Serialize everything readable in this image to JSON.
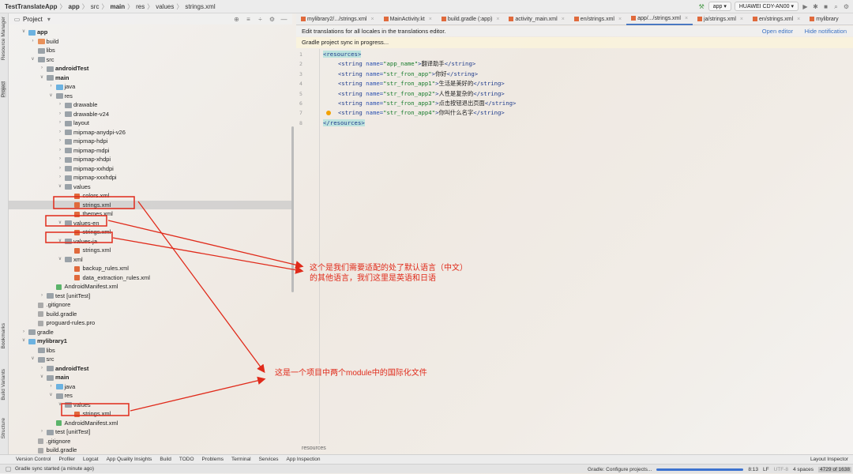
{
  "breadcrumb": [
    "TestTranslateApp",
    "app",
    "src",
    "main",
    "res",
    "values",
    "strings.xml"
  ],
  "run": {
    "config": "app",
    "device": "HUAWEI CDY-AN00"
  },
  "project_panel": {
    "title": "Project"
  },
  "side_tools": [
    "Resource Manager",
    "Project",
    "Bookmarks",
    "Build Variants",
    "Structure"
  ],
  "tree": [
    {
      "label": "app",
      "level": 0,
      "icon": "module",
      "open": true,
      "bold": true
    },
    {
      "label": "build",
      "level": 1,
      "icon": "folder-orange",
      "open": false
    },
    {
      "label": "libs",
      "level": 1,
      "icon": "folder"
    },
    {
      "label": "src",
      "level": 1,
      "icon": "folder",
      "open": true
    },
    {
      "label": "androidTest",
      "level": 2,
      "icon": "folder",
      "open": false,
      "bold": true
    },
    {
      "label": "main",
      "level": 2,
      "icon": "folder",
      "open": true,
      "bold": true
    },
    {
      "label": "java",
      "level": 3,
      "icon": "folder-blue",
      "open": false
    },
    {
      "label": "res",
      "level": 3,
      "icon": "folder",
      "open": true
    },
    {
      "label": "drawable",
      "level": 4,
      "icon": "folder",
      "open": false
    },
    {
      "label": "drawable-v24",
      "level": 4,
      "icon": "folder",
      "open": false
    },
    {
      "label": "layout",
      "level": 4,
      "icon": "folder",
      "open": false
    },
    {
      "label": "mipmap-anydpi-v26",
      "level": 4,
      "icon": "folder",
      "open": false
    },
    {
      "label": "mipmap-hdpi",
      "level": 4,
      "icon": "folder",
      "open": false
    },
    {
      "label": "mipmap-mdpi",
      "level": 4,
      "icon": "folder",
      "open": false
    },
    {
      "label": "mipmap-xhdpi",
      "level": 4,
      "icon": "folder",
      "open": false
    },
    {
      "label": "mipmap-xxhdpi",
      "level": 4,
      "icon": "folder",
      "open": false
    },
    {
      "label": "mipmap-xxxhdpi",
      "level": 4,
      "icon": "folder",
      "open": false
    },
    {
      "label": "values",
      "level": 4,
      "icon": "folder",
      "open": true
    },
    {
      "label": "colors.xml",
      "level": 5,
      "icon": "xml"
    },
    {
      "label": "strings.xml",
      "level": 5,
      "icon": "xml",
      "selected": true
    },
    {
      "label": "themes.xml",
      "level": 5,
      "icon": "xml"
    },
    {
      "label": "values-en",
      "level": 4,
      "icon": "folder",
      "open": true
    },
    {
      "label": "strings.xml",
      "level": 5,
      "icon": "xml"
    },
    {
      "label": "values-ja",
      "level": 4,
      "icon": "folder",
      "open": true
    },
    {
      "label": "strings.xml",
      "level": 5,
      "icon": "xml"
    },
    {
      "label": "xml",
      "level": 4,
      "icon": "folder",
      "open": true
    },
    {
      "label": "backup_rules.xml",
      "level": 5,
      "icon": "xml"
    },
    {
      "label": "data_extraction_rules.xml",
      "level": 5,
      "icon": "xml"
    },
    {
      "label": "AndroidManifest.xml",
      "level": 3,
      "icon": "manifest"
    },
    {
      "label": "test [unitTest]",
      "level": 2,
      "icon": "folder",
      "open": false
    },
    {
      "label": ".gitignore",
      "level": 1,
      "icon": "text"
    },
    {
      "label": "build.gradle",
      "level": 1,
      "icon": "gradle"
    },
    {
      "label": "proguard-rules.pro",
      "level": 1,
      "icon": "text"
    },
    {
      "label": "gradle",
      "level": 0,
      "icon": "folder",
      "open": false
    },
    {
      "label": "mylibrary1",
      "level": 0,
      "icon": "module",
      "open": true,
      "bold": true
    },
    {
      "label": "libs",
      "level": 1,
      "icon": "folder"
    },
    {
      "label": "src",
      "level": 1,
      "icon": "folder",
      "open": true
    },
    {
      "label": "androidTest",
      "level": 2,
      "icon": "folder",
      "open": false,
      "bold": true
    },
    {
      "label": "main",
      "level": 2,
      "icon": "folder",
      "open": true,
      "bold": true
    },
    {
      "label": "java",
      "level": 3,
      "icon": "folder-blue",
      "open": false
    },
    {
      "label": "res",
      "level": 3,
      "icon": "folder",
      "open": true
    },
    {
      "label": "values",
      "level": 4,
      "icon": "folder",
      "open": true
    },
    {
      "label": "strings.xml",
      "level": 5,
      "icon": "xml"
    },
    {
      "label": "AndroidManifest.xml",
      "level": 3,
      "icon": "manifest"
    },
    {
      "label": "test [unitTest]",
      "level": 2,
      "icon": "folder",
      "open": false
    },
    {
      "label": ".gitignore",
      "level": 1,
      "icon": "text"
    },
    {
      "label": "build.gradle",
      "level": 1,
      "icon": "gradle"
    }
  ],
  "tabs": [
    {
      "label": "mylibrary2/.../strings.xml"
    },
    {
      "label": "MainActivity.kt"
    },
    {
      "label": "build.gradle (:app)"
    },
    {
      "label": "activity_main.xml"
    },
    {
      "label": "en/strings.xml"
    },
    {
      "label": "app/.../strings.xml",
      "active": true
    },
    {
      "label": "ja/strings.xml"
    },
    {
      "label": "en/strings.xml"
    },
    {
      "label": "mylibrary"
    }
  ],
  "notification": {
    "text": "Edit translations for all locales in the translations editor.",
    "open_editor": "Open editor",
    "hide": "Hide notification"
  },
  "sync_banner": "Gradle project sync in progress...",
  "code": [
    {
      "n": "1",
      "open": "resources"
    },
    {
      "n": "2",
      "name": "app_name",
      "value": "翻译助手"
    },
    {
      "n": "3",
      "name": "str_fron_app",
      "value": "你好"
    },
    {
      "n": "4",
      "name": "str_fron_app1",
      "value": "生活是美好的"
    },
    {
      "n": "5",
      "name": "str_fron_app2",
      "value": "人性是复杂的"
    },
    {
      "n": "6",
      "name": "str_fron_app3",
      "value": "点击按钮退出页面"
    },
    {
      "n": "7",
      "name": "str_fron_app4",
      "value": "你叫什么名字",
      "bulb": true
    },
    {
      "n": "8",
      "close": "resources"
    }
  ],
  "editor_footer": "resources",
  "tool_windows": [
    "Version Control",
    "Profiler",
    "Logcat",
    "App Quality Insights",
    "Build",
    "TODO",
    "Problems",
    "Terminal",
    "Services",
    "App Inspection"
  ],
  "layout_inspector": "Layout Inspector",
  "status": {
    "left": "Gradle sync started (a minute ago)",
    "task": "Gradle: Configure projects...",
    "position": "8:13",
    "line_sep": "LF",
    "encoding": "UTF-8",
    "indent": "4 spaces",
    "memory": "4729 of 1638"
  },
  "annotations": {
    "other_languages": [
      "这个是我们需要适配的处了默认语言（中文）",
      "的其他语言，我们这里是英语和日语"
    ],
    "modules": "这是一个项目中两个module中的国际化文件"
  },
  "colors": {
    "annotation_red": "#e02a1a",
    "accent_blue": "#3b72c4"
  }
}
